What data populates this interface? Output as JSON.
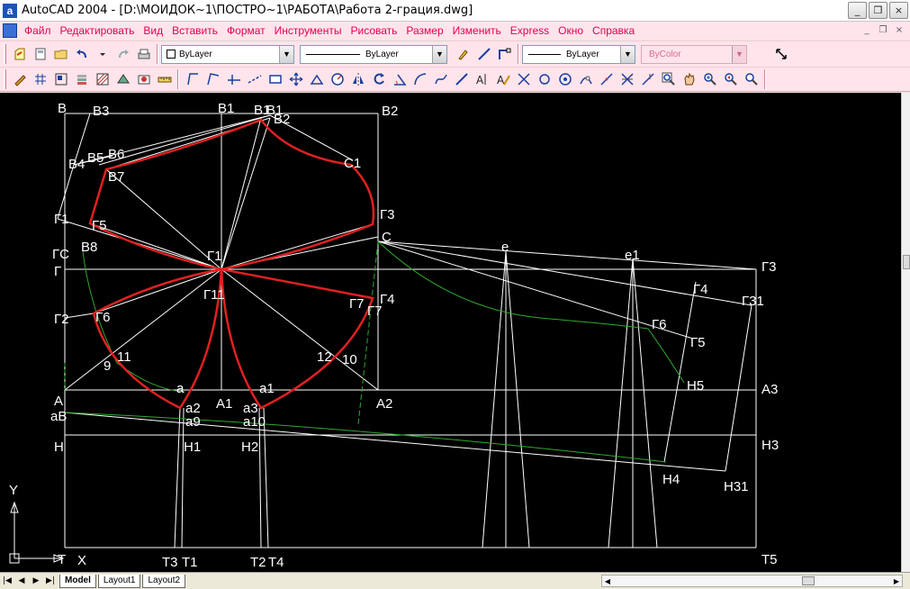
{
  "window": {
    "title": "AutoCAD 2004 - [D:\\МОИДОК~1\\ПОСТРО~1\\РАБОТА\\Работа 2-грация.dwg]",
    "app_icon_letter": "a",
    "buttons": {
      "minimize": "_",
      "restore": "❐",
      "close": "×"
    }
  },
  "menubar": {
    "items": [
      "Файл",
      "Редактировать",
      "Вид",
      "Вставить",
      "Формат",
      "Инструменты",
      "Рисовать",
      "Размер",
      "Изменить",
      "Express",
      "Окно",
      "Справка"
    ],
    "doc_controls": {
      "minimize": "_",
      "restore": "❐",
      "close": "×"
    }
  },
  "properties_toolbar": {
    "layer_combo": "ByLayer",
    "linetype_combo": "ByLayer",
    "lineweight_combo": "ByLayer",
    "color_combo": "ByColor"
  },
  "layout_tabs": [
    "Model",
    "Layout1",
    "Layout2"
  ],
  "drawing": {
    "ucs": {
      "x_label": "X",
      "y_label": "Y"
    },
    "labels": [
      "B",
      "B3",
      "B1",
      "B1",
      "B1",
      "B2",
      "B2",
      "C1",
      "B5",
      "B6",
      "B4",
      "B7",
      "Г1",
      "Г5",
      "Г3",
      "B8",
      "C",
      "ГC",
      "Г",
      "Г1",
      "Г11",
      "Г7",
      "Г7",
      "Г4",
      "Г2",
      "Г6",
      "11",
      "9",
      "12",
      "10",
      "A",
      "A1",
      "a",
      "a1",
      "a2",
      "a3",
      "A2",
      "aB",
      "a9",
      "a10",
      "H",
      "H1",
      "H2",
      "H3",
      "T",
      "T3",
      "T1",
      "T2",
      "T4",
      "T5",
      "e",
      "e1",
      "Г3",
      "Г4",
      "Г31",
      "Г6",
      "Г5",
      "H5",
      "A3",
      "H4",
      "H31"
    ]
  },
  "colors": {
    "title_bg": "#ffffff",
    "bar_bg": "#ffe4ec",
    "menu_text": "#e2004f",
    "canvas": "#000000",
    "line_white": "#ffffff",
    "line_red": "#e02020",
    "line_green": "#2faa2f"
  }
}
